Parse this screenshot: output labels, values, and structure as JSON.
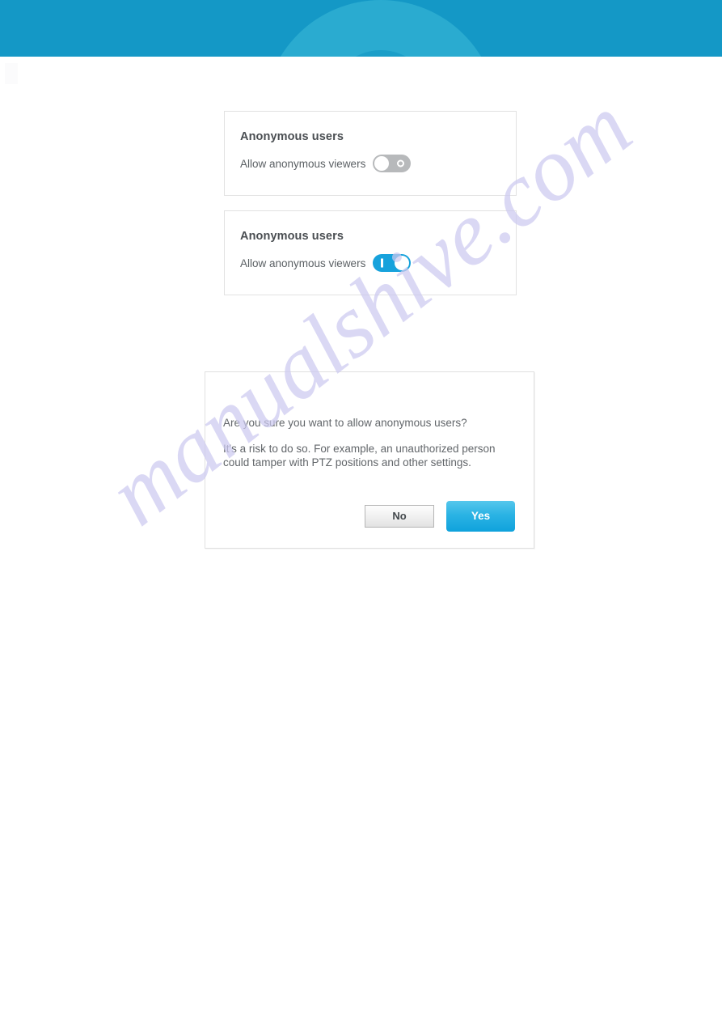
{
  "header": {
    "background_color": "#1498c6",
    "circle_large_color": "#2aabd0",
    "circle_small_color": "#1b9ec8"
  },
  "cards": [
    {
      "title": "Anonymous users",
      "row_label": "Allow anonymous viewers",
      "toggle_state": "off",
      "toggle_color": "#b7b9bb"
    },
    {
      "title": "Anonymous users",
      "row_label": "Allow anonymous viewers",
      "toggle_state": "on",
      "toggle_color": "#17a2dc"
    }
  ],
  "dialog": {
    "question": "Are you sure you want to allow anonymous users?",
    "detail": "It's a risk to do so. For example, an unauthorized person could tamper with PTZ positions and other settings.",
    "buttons": {
      "no_label": "No",
      "yes_label": "Yes",
      "yes_color": "#1fb0e2"
    }
  },
  "watermark": {
    "text": "manualshive.com",
    "color": "#cdcaf0"
  }
}
